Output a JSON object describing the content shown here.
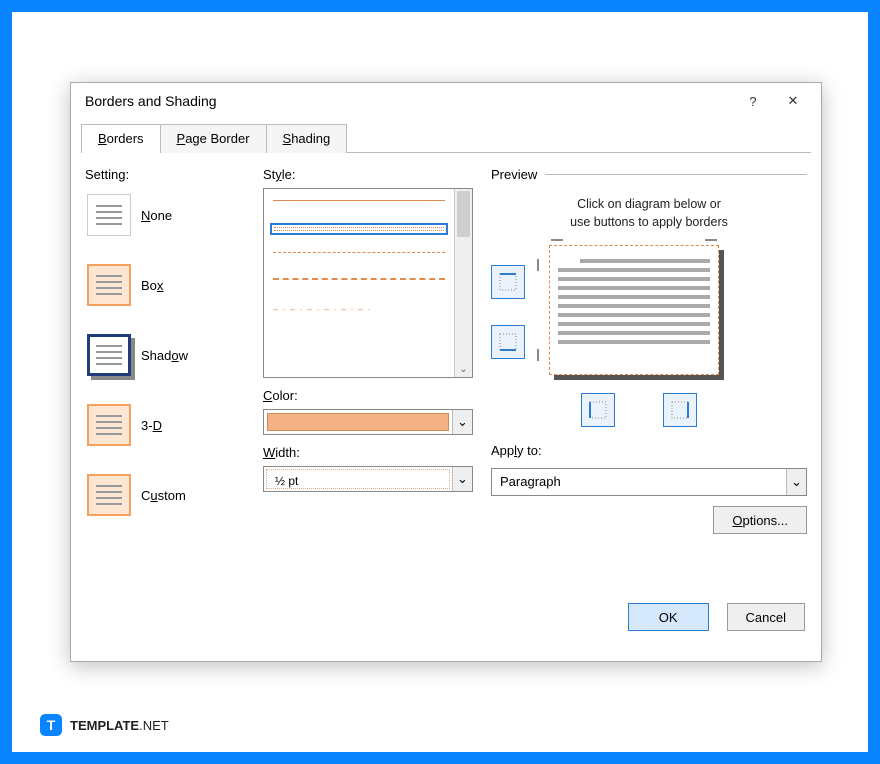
{
  "dialog": {
    "title": "Borders and Shading",
    "help_label": "?",
    "close_label": "✕"
  },
  "tabs": [
    {
      "label_pre": "",
      "label_u": "B",
      "label_post": "orders",
      "active": true
    },
    {
      "label_pre": "",
      "label_u": "P",
      "label_post": "age Border",
      "active": false
    },
    {
      "label_pre": "",
      "label_u": "S",
      "label_post": "hading",
      "active": false
    }
  ],
  "setting": {
    "label": "Setting:",
    "items": [
      {
        "label_pre": "",
        "label_u": "N",
        "label_post": "one",
        "kind": "none"
      },
      {
        "label_pre": "Bo",
        "label_u": "x",
        "label_post": "",
        "kind": "box"
      },
      {
        "label_pre": "Shad",
        "label_u": "o",
        "label_post": "w",
        "kind": "shadow",
        "selected": true
      },
      {
        "label_pre": "3-",
        "label_u": "D",
        "label_post": "",
        "kind": "3d"
      },
      {
        "label_pre": "C",
        "label_u": "u",
        "label_post": "stom",
        "kind": "custom"
      }
    ]
  },
  "style": {
    "label_pre": "St",
    "label_u": "y",
    "label_post": "le:",
    "selected_index": 1
  },
  "color": {
    "label_pre": "",
    "label_u": "C",
    "label_post": "olor:",
    "value": "#f4b183"
  },
  "width": {
    "label_pre": "",
    "label_u": "W",
    "label_post": "idth:",
    "value": "½ pt"
  },
  "preview": {
    "label": "Preview",
    "hint1": "Click on diagram below or",
    "hint2": "use buttons to apply borders"
  },
  "apply": {
    "label_pre": "App",
    "label_u": "l",
    "label_post": "y to:",
    "value": "Paragraph"
  },
  "options": {
    "label_pre": "",
    "label_u": "O",
    "label_post": "ptions..."
  },
  "footer": {
    "ok": "OK",
    "cancel": "Cancel"
  },
  "brand": {
    "bold": "TEMPLATE",
    "light": ".NET",
    "logo": "T"
  }
}
